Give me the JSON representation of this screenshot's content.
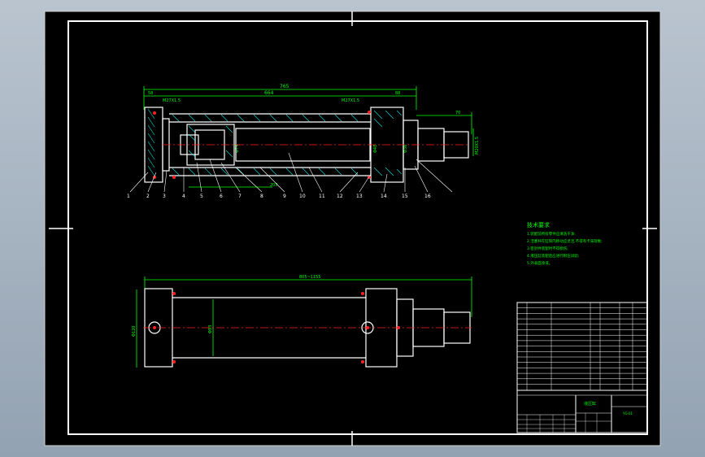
{
  "drawing": {
    "dims": {
      "overall_length": "765",
      "rod_extension": "664",
      "left_offset": "58",
      "right_offset": "88",
      "end_width": "70",
      "thread_left": "M27X1.5",
      "thread_right": "M27X1.5",
      "bottom_dim": "205",
      "bottom_view_length": "805~1155",
      "bore_diameter": "Φ74",
      "rod_diameter": "Φ48",
      "port_diameter": "Φ36",
      "tip_thread": "M20X1.5",
      "bottom_height": "Φ120",
      "bottom_body": "Φ93"
    },
    "balloons": [
      "1",
      "2",
      "3",
      "4",
      "5",
      "6",
      "7",
      "8",
      "9",
      "10",
      "11",
      "12",
      "13",
      "14",
      "15",
      "16"
    ],
    "notes": {
      "heading": "技术要求",
      "lines": [
        "1.装配前所有零件应清洗干净;",
        "2.活塞杆在缸筒内移动应灵活,不得有卡滞现象;",
        "3.密封件装配时不得损伤;",
        "4.液压缸装配后应进行耐压试验;",
        "5.外表面涂漆。"
      ]
    },
    "title_block": {
      "name": "液压缸",
      "code": "YG-01"
    }
  }
}
